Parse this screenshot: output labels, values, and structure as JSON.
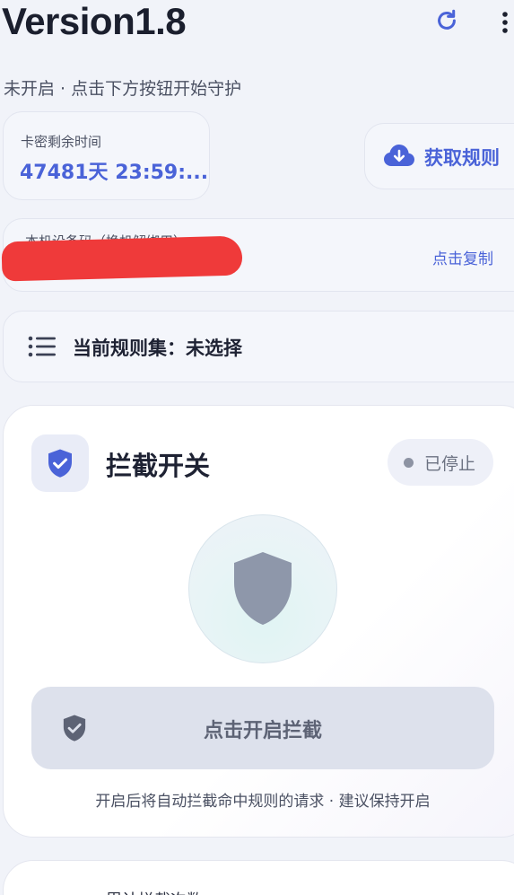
{
  "header": {
    "title": "Version1.8",
    "refresh_icon": "refresh-icon",
    "more_icon": "more-vertical-icon"
  },
  "status_line": "未开启 · 点击下方按钮开始守护",
  "license": {
    "label": "卡密剩余时间",
    "value": "47481天 23:59:..."
  },
  "rules_button": {
    "label": "获取规则",
    "icon": "cloud-download-icon"
  },
  "device": {
    "label": "本机设备码（换机解绑用）",
    "copy_label": "点击复制"
  },
  "ruleset": {
    "icon": "list-icon",
    "text": "当前规则集：未选择"
  },
  "intercept": {
    "title": "拦截开关",
    "status": "已停止",
    "button_label": "点击开启拦截",
    "hint": "开启后将自动拦截命中规则的请求 · 建议保持开启"
  },
  "stats": {
    "label": "累计拦截次数"
  },
  "colors": {
    "accent": "#4a63d8",
    "shield_active": "#4a63d8",
    "shield_inactive": "#8e97aa",
    "redaction": "#ef3a3a"
  }
}
